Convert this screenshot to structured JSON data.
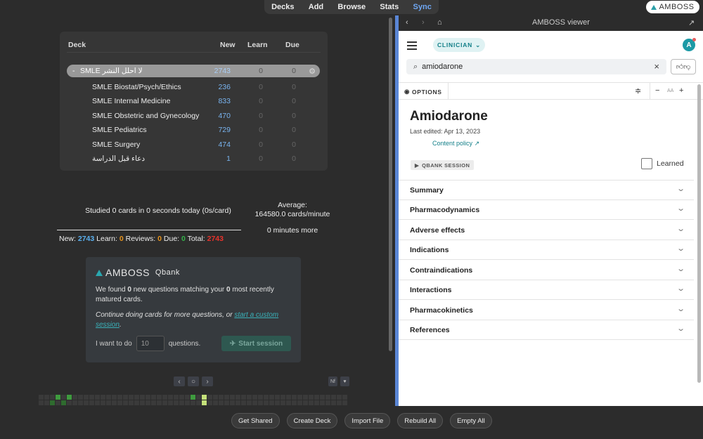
{
  "topnav": {
    "items": [
      "Decks",
      "Add",
      "Browse",
      "Stats",
      "Sync"
    ]
  },
  "amboss_button": "AMBOSS",
  "deck_table": {
    "headers": {
      "deck": "Deck",
      "new": "New",
      "learn": "Learn",
      "due": "Due"
    },
    "selected": {
      "collapse": "-",
      "name": "SMLE لا احلل النشر",
      "new": "2743",
      "learn": "0",
      "due": "0"
    },
    "rows": [
      {
        "name": "SMLE Biostat/Psych/Ethics",
        "new": "236",
        "learn": "0",
        "due": "0"
      },
      {
        "name": "SMLE Internal Medicine",
        "new": "833",
        "learn": "0",
        "due": "0"
      },
      {
        "name": "SMLE Obstetric and Gynecology",
        "new": "470",
        "learn": "0",
        "due": "0"
      },
      {
        "name": "SMLE Pediatrics",
        "new": "729",
        "learn": "0",
        "due": "0"
      },
      {
        "name": "SMLE Surgery",
        "new": "474",
        "learn": "0",
        "due": "0"
      },
      {
        "name": "دعاء قبل الدراسة",
        "new": "1",
        "learn": "0",
        "due": "0"
      }
    ]
  },
  "stats": {
    "studied": "Studied 0 cards in 0 seconds today (0s/card)",
    "average_label": "Average:",
    "average_value": "164580.0 cards/minute",
    "minutes_more": "0 minutes more",
    "new_label": "New:",
    "new_val": "2743",
    "learn_label": "Learn:",
    "learn_val": "0",
    "reviews_label": "Reviews:",
    "reviews_val": "0",
    "due_label": "Due:",
    "due_val": "0",
    "total_label": "Total:",
    "total_val": "2743"
  },
  "qbank": {
    "brand": "AMBOSS",
    "product": "Qbank",
    "found_pre": "We found ",
    "found_n1": "0",
    "found_mid": " new questions matching your ",
    "found_n2": "0",
    "found_post": " most recently matured cards.",
    "continue_pre": "Continue doing cards for more questions, or ",
    "continue_link": "start a custom session",
    "continue_post": ".",
    "want_pre": "I want to do",
    "want_value": "10",
    "want_post": "questions.",
    "start_label": "Start session"
  },
  "pager": {
    "prev": "‹",
    "today": "○",
    "next": "›",
    "nf": "Nf",
    "heart": "♥"
  },
  "heatmap": {
    "columns": 55,
    "rows": 2,
    "colors": {
      "empty": "#3a3a3a",
      "low": "#2f6b2f",
      "mid": "#3e9b3e",
      "high": "#c4e07a"
    },
    "active": [
      {
        "row": 0,
        "col": 3,
        "level": "mid"
      },
      {
        "row": 1,
        "col": 4,
        "level": "low"
      },
      {
        "row": 0,
        "col": 5,
        "level": "mid"
      },
      {
        "row": 1,
        "col": 2,
        "level": "low"
      },
      {
        "row": 0,
        "col": 27,
        "level": "mid"
      },
      {
        "row": 0,
        "col": 29,
        "level": "high"
      },
      {
        "row": 1,
        "col": 29,
        "level": "high"
      }
    ]
  },
  "bottom_buttons": [
    "Get Shared",
    "Create Deck",
    "Import File",
    "Rebuild All",
    "Empty All"
  ],
  "viewer": {
    "window_title": "AMBOSS viewer",
    "role": "CLINICIAN",
    "avatar": "A",
    "search_value": "amiodarone",
    "options": "OPTIONS",
    "text_size": "AA",
    "title": "Amiodarone",
    "last_edited": "Last edited: Apr 13, 2023",
    "policy": "Content policy",
    "qbank_session": "QBANK SESSION",
    "learned": "Learned",
    "sections": [
      "Summary",
      "Pharmacodynamics",
      "Adverse effects",
      "Indications",
      "Contraindications",
      "Interactions",
      "Pharmacokinetics",
      "References"
    ]
  }
}
